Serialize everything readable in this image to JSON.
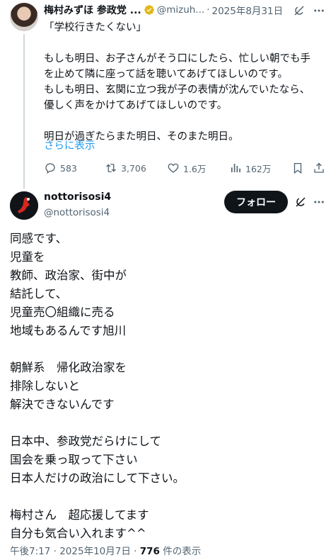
{
  "parent_tweet": {
    "author_name": "梅村みずほ 参政党 ...",
    "handle": "@mizuh...",
    "date_sep": "·",
    "date": "2025年8月31日",
    "text_lines": [
      "「学校行きたくない」",
      "",
      "もしも明日、お子さんがそう口にしたら、忙しい朝でも手",
      "を止めて隣に座って話を聴いてあげてほしいのです。",
      "もしも明日、玄関に立つ我が子の表情が沈んでいたなら、",
      "優しく声をかけてあげてほしいのです。",
      "",
      "明日が過ぎたらまた明日、そのまた明日。"
    ],
    "show_more": "さらに表示",
    "stats": {
      "replies": "583",
      "reposts": "3,706",
      "likes": "1.6万",
      "views": "162万"
    },
    "icons": {
      "verified": "verified-badge-icon",
      "grok": "grok-icon",
      "more": "more-icon",
      "reply": "reply-icon",
      "repost": "repost-icon",
      "like": "like-icon",
      "views": "views-icon",
      "bookmark": "bookmark-icon",
      "share": "share-icon"
    }
  },
  "reply_tweet": {
    "author_name": "nottorisosi4",
    "handle": "@nottorisosi4",
    "follow_label": "フォロー",
    "text_lines": [
      "同感です、",
      "児童を",
      "教師、政治家、街中が",
      "結託して、",
      "児童売〇組織に売る",
      "地域もあるんです旭川",
      "",
      "朝鮮系　帰化政治家を",
      "排除しないと",
      "解決できないんです",
      "",
      "日本中、参政党だらけにして",
      "国会を乗っ取って下さい",
      "日本人だけの政治にして下さい。",
      "",
      "梅村さん　超応援してます",
      "自分も気合い入れます^^"
    ],
    "time": "午後7:17",
    "date_sep": "·",
    "date": "2025年10月7日",
    "views_count": "776",
    "views_label": "件の表示"
  },
  "colors": {
    "text": "#0f1419",
    "secondary": "#536471",
    "link": "#1d9bf0",
    "verified": "#e2b719",
    "thread_line": "#cfd9de",
    "follow_bg": "#0f1419"
  }
}
